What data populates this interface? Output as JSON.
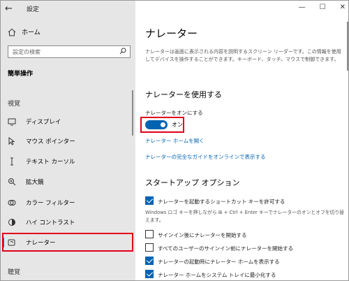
{
  "window": {
    "title": "設定"
  },
  "sidebar": {
    "home_label": "ホーム",
    "search_placeholder": "設定の検索",
    "section_title": "簡単操作",
    "group_vision": "視覚",
    "group_hearing": "聴覚",
    "items": [
      {
        "label": "ディスプレイ",
        "icon": "display-icon"
      },
      {
        "label": "マウス ポインター",
        "icon": "mouse-pointer-icon"
      },
      {
        "label": "テキスト カーソル",
        "icon": "text-cursor-icon"
      },
      {
        "label": "拡大鏡",
        "icon": "magnifier-icon"
      },
      {
        "label": "カラー フィルター",
        "icon": "color-filter-icon"
      },
      {
        "label": "ハイ コントラスト",
        "icon": "high-contrast-icon"
      },
      {
        "label": "ナレーター",
        "icon": "narrator-icon",
        "active": true
      }
    ]
  },
  "main": {
    "title": "ナレーター",
    "description": "ナレーターは画面に表示される内容を説明するスクリーン リーダーです。この情報を使用してデバイスを操作することができます。キーボード、タッチ、マウスで制御できます。",
    "use_heading": "ナレーターを使用する",
    "toggle_label": "ナレーターをオンにする",
    "toggle_state": "オン",
    "link_home": "ナレーター ホームを開く",
    "link_guide": "ナレーターの完全なガイドをオンラインで表示する",
    "startup_heading": "スタートアップ オプション",
    "options": [
      {
        "label": "ナレーターを起動するショートカット キーを許可する",
        "checked": true
      },
      {
        "label": "サインイン後にナレーターを開始する",
        "checked": false
      },
      {
        "label": "すべてのユーザーのサインイン前にナレーターを開始する",
        "checked": false
      },
      {
        "label": "ナレーターの起動時にナレーター ホームを表示する",
        "checked": true
      },
      {
        "label": "ナレーター ホームをシステム トレイに最小化する",
        "checked": true
      }
    ],
    "shortcut_note": "Windows ロゴ キーを押しながら ⊞ + Ctrl + Enter キーでナレーターのオンとオフを切り替えます。"
  },
  "colors": {
    "accent": "#0063b1",
    "highlight": "#e1001a",
    "sidebar_bg": "#e6e6e6"
  }
}
